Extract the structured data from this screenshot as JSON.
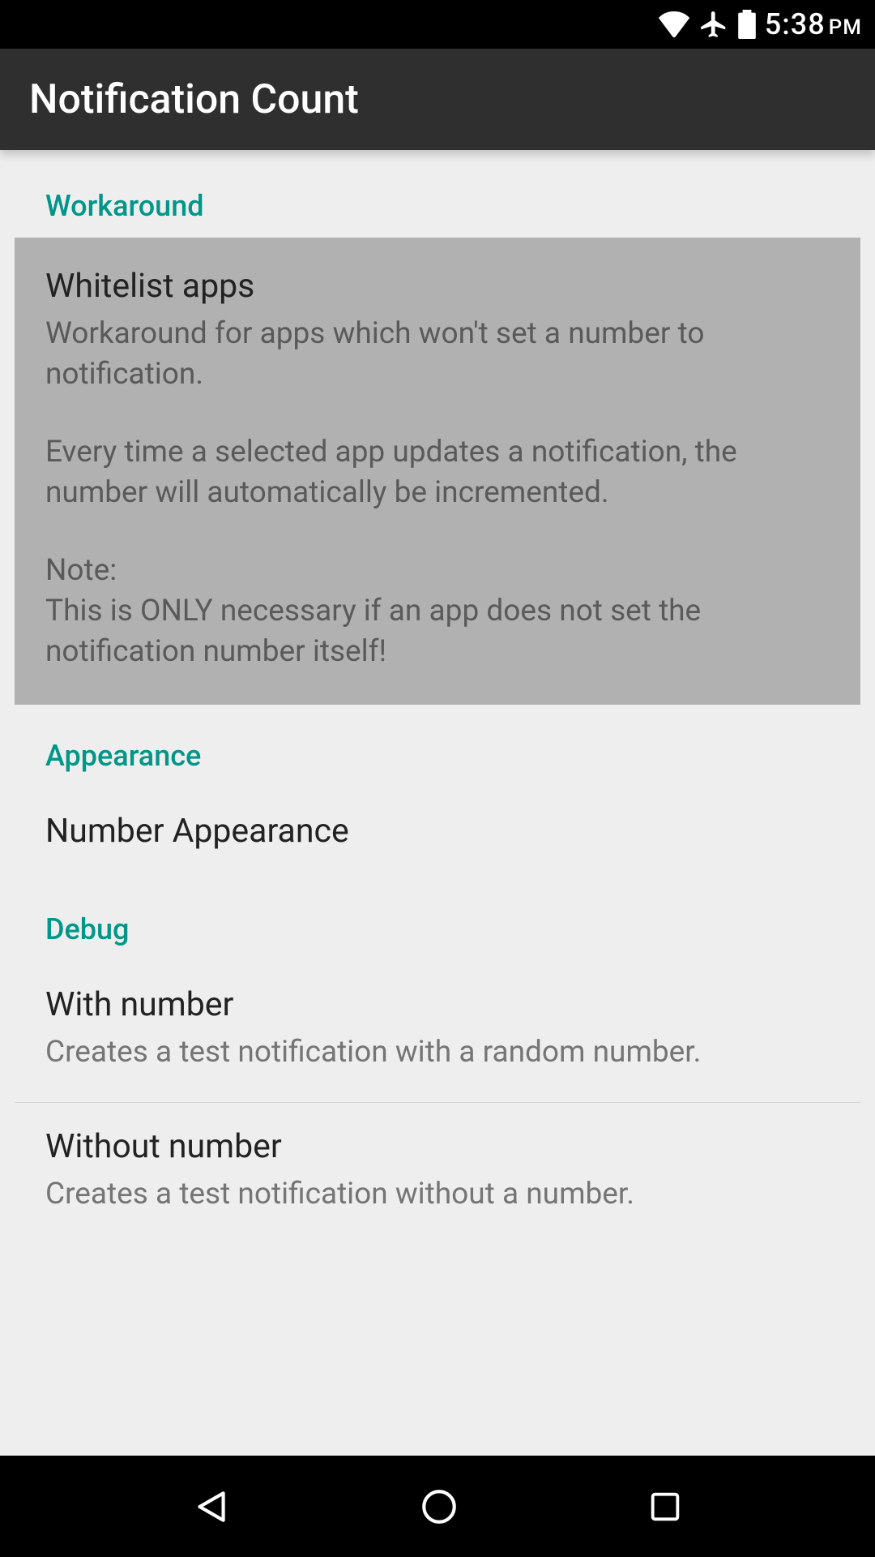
{
  "statusbar": {
    "time": "5:38",
    "ampm": "PM"
  },
  "actionbar": {
    "title": "Notification Count"
  },
  "sections": {
    "workaround": {
      "header": "Workaround",
      "whitelist": {
        "title": "Whitelist apps",
        "p1": "Workaround for apps which won't set a number to notification.",
        "p2": "Every time a selected app updates a notification, the number will automatically be incremented.",
        "p3a": "Note:",
        "p3b": "This is ONLY necessary if an app does not set the notification number itself!"
      }
    },
    "appearance": {
      "header": "Appearance",
      "number_appearance": {
        "title": "Number Appearance"
      }
    },
    "debug": {
      "header": "Debug",
      "with_number": {
        "title": "With number",
        "subtitle": "Creates a test notification with a random number."
      },
      "without_number": {
        "title": "Without number",
        "subtitle": "Creates a test notification without a number."
      }
    }
  }
}
